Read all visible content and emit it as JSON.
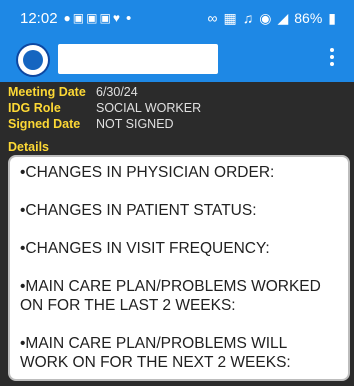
{
  "status_bar": {
    "time": "12:02",
    "notification_icons": [
      "chat-icon",
      "photo-icon",
      "photo-icon",
      "photo-icon",
      "heart-icon"
    ],
    "dot": "•",
    "battery": "86%"
  },
  "appbar": {
    "menu_icon": "overflow-menu-icon"
  },
  "meeting": {
    "fields": [
      {
        "label": "Meeting Date",
        "value": "6/30/24"
      },
      {
        "label": "IDG Role",
        "value": "SOCIAL WORKER"
      },
      {
        "label": "Signed Date",
        "value": "NOT SIGNED"
      }
    ],
    "details_label": "Details",
    "details_lines": [
      "•CHANGES IN PHYSICIAN ORDER:",
      "•CHANGES IN PATIENT STATUS:",
      "•CHANGES IN VISIT FREQUENCY:",
      "•MAIN CARE PLAN/PROBLEMS WORKED ON FOR THE LAST 2 WEEKS:",
      "•MAIN CARE PLAN/PROBLEMS WILL WORK ON FOR THE NEXT 2 WEEKS:"
    ]
  },
  "colors": {
    "header_blue": "#1e88e5",
    "label_yellow": "#fdd835",
    "background": "#2b2b2b"
  }
}
